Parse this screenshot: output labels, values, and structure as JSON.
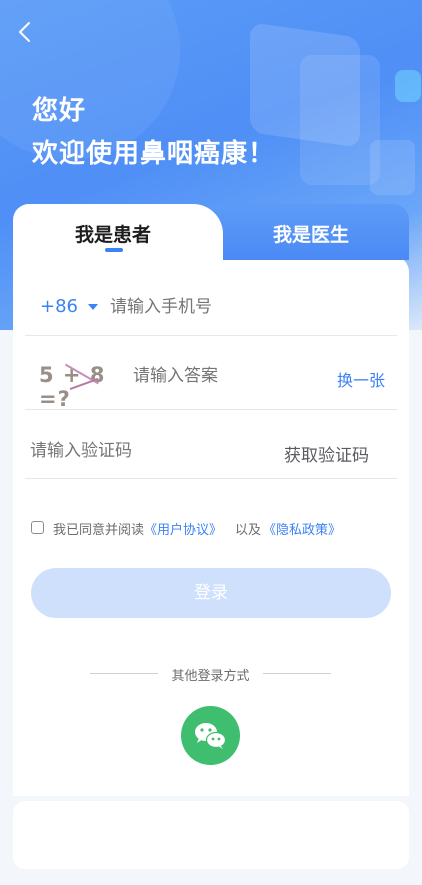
{
  "header": {
    "greeting_line1": "您好",
    "greeting_line2": "欢迎使用鼻咽癌康！"
  },
  "tabs": {
    "patient": "我是患者",
    "doctor": "我是医生",
    "active": "patient"
  },
  "phone": {
    "country_code": "+86",
    "placeholder": "请输入手机号"
  },
  "captcha": {
    "image_text": "5 + 8 =?",
    "placeholder": "请输入答案",
    "refresh_label": "换一张"
  },
  "sms": {
    "placeholder": "请输入验证码",
    "get_code_label": "获取验证码"
  },
  "agreement": {
    "prefix": "我已同意并阅读",
    "user_agreement": "《用户协议》",
    "and": "以及",
    "privacy_policy": "《隐私政策》",
    "checked": false
  },
  "login": {
    "label": "登录"
  },
  "other_login": {
    "label": "其他登录方式",
    "wechat_icon": "wechat-icon"
  },
  "colors": {
    "accent": "#3b82f6",
    "wechat": "#3fbe6f",
    "login_disabled": "#cfe0fd"
  }
}
